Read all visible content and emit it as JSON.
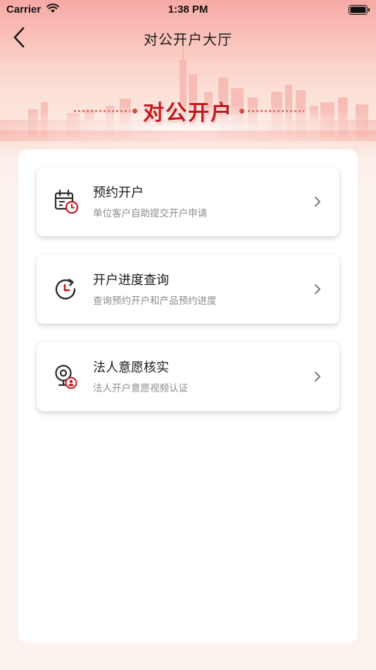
{
  "status_bar": {
    "carrier": "Carrier",
    "time": "1:38 PM",
    "wifi_icon": "wifi-icon",
    "battery_icon": "battery-icon"
  },
  "nav": {
    "title": "对公开户大厅",
    "back_icon": "chevron-left-icon"
  },
  "banner": {
    "title": "对公开户"
  },
  "menu": [
    {
      "title": "预约开户",
      "subtitle": "单位客户自助提交开户申请",
      "icon": "calendar-clock-icon"
    },
    {
      "title": "开户进度查询",
      "subtitle": "查询预约开户和产品预约进度",
      "icon": "clock-refresh-icon"
    },
    {
      "title": "法人意愿核实",
      "subtitle": "法人开户意愿视频认证",
      "icon": "webcam-person-icon"
    }
  ],
  "colors": {
    "accent": "#c4181c",
    "icon_dark": "#2b2b2b",
    "page_background": "#fdf3ee"
  }
}
